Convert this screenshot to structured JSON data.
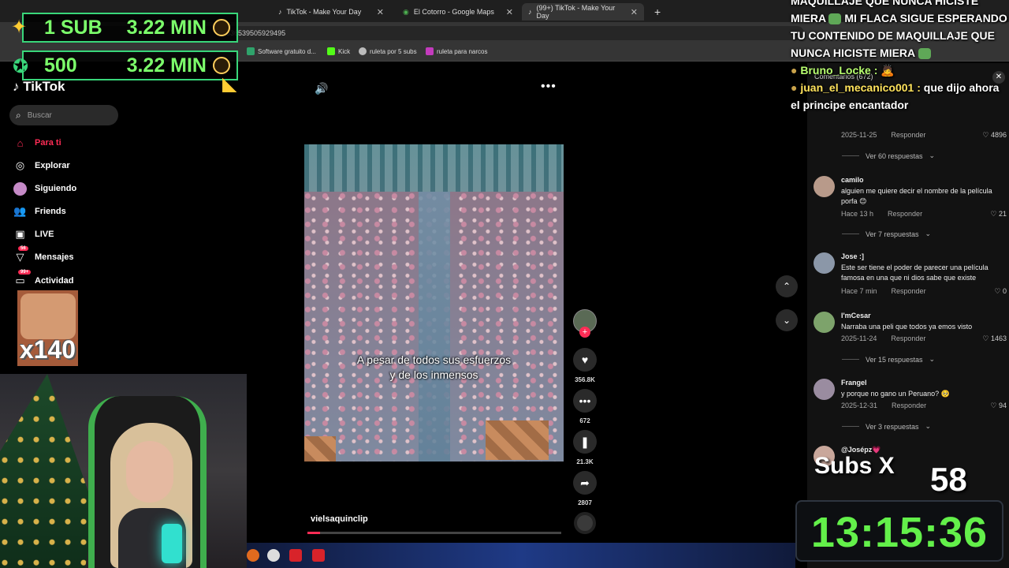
{
  "browser": {
    "tabs": [
      {
        "label": "TikTok - Make Your Day"
      },
      {
        "label": "El Cotorro - Google Maps"
      },
      {
        "label": "(99+) TikTok - Make Your Day"
      }
    ],
    "url_fragment": "7536539505929495",
    "bookmarks": [
      "Software gratuito d...",
      "Kick",
      "ruleta por 5 subs",
      "ruleta para narcos"
    ]
  },
  "tiktok": {
    "search_placeholder": "Buscar",
    "nav": [
      {
        "label": "Para ti",
        "icon": "home-icon"
      },
      {
        "label": "Explorar",
        "icon": "compass-icon"
      },
      {
        "label": "Siguiendo",
        "icon": "following-icon"
      },
      {
        "label": "Friends",
        "icon": "friends-icon"
      },
      {
        "label": "LIVE",
        "icon": "live-icon"
      },
      {
        "label": "Mensajes",
        "icon": "messages-icon",
        "badge": "56"
      },
      {
        "label": "Actividad",
        "icon": "activity-icon",
        "badge": "99+"
      }
    ],
    "video": {
      "caption_line1": "A pesar de todos sus esfuerzos",
      "caption_line2": "y de los inmensos",
      "author": "vielsaquinclip",
      "progress_fraction": 0.05
    },
    "actions": {
      "likes": "356.8K",
      "comments": "672",
      "saves": "21.3K",
      "shares": "2807"
    }
  },
  "overlay": {
    "row1_label": "1 SUB",
    "row1_value": "3.22 MIN",
    "row2_label": "500",
    "row2_value": "3.22 MIN",
    "emote_count": "x140"
  },
  "chat": {
    "line1_text": "MAQUILLAJE QUE NUNCA HICISTE MIERA",
    "line1_text2": "MI FLACA SIGUE ESPERANDO TU CONTENIDO DE MAQUILLAJE QUE NUNCA HICISTE MIERA",
    "user2": "Bruno_Locke :",
    "user3": "juan_el_mecanico001 :",
    "user3_text": "que dijo ahora el principe encantador"
  },
  "comments": {
    "header": "Comentarios (672)",
    "items": [
      {
        "name": "camilo",
        "text": "alguien me quiere decir el nombre de la película porfa 😊",
        "time": "Hace 13 h",
        "reply": "Responder",
        "likes": "21"
      },
      {
        "name": "Jose :]",
        "text": "Este ser tiene el poder de parecer una película famosa en una que ni dios sabe que existe",
        "time": "Hace 7 min",
        "reply": "Responder",
        "likes": "0"
      },
      {
        "name": "I'mCesar",
        "text": "Narraba una peli que todos ya emos visto",
        "time": "2025-11-24",
        "reply": "Responder",
        "likes": "1463"
      },
      {
        "name": "Frangel",
        "text": "y porque no gano un Peruano? 🥺",
        "time": "2025-12-31",
        "reply": "Responder",
        "likes": "94"
      },
      {
        "name": "@Josépz💗",
        "text": "",
        "time": "",
        "reply": "",
        "likes": ""
      }
    ],
    "first_top": {
      "time": "2025-11-25",
      "reply": "Responder",
      "likes": "4896"
    },
    "replies": [
      "Ver 60 respuestas",
      "Ver 7 respuestas",
      "Ver 15 respuestas",
      "Ver 3 respuestas"
    ]
  },
  "subathon": {
    "subs_label": "Subs X",
    "subs_value": "58",
    "timer": "13:15:36"
  }
}
